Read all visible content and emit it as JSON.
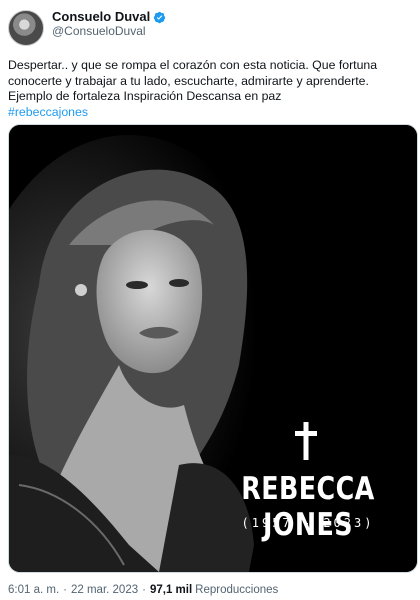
{
  "author": {
    "display_name": "Consuelo Duval",
    "handle": "@ConsueloDuval",
    "verified": true
  },
  "tweet": {
    "text": "Despertar.. y que se rompa el corazón con esta noticia. Que fortuna conocerte y trabajar a tu lado, escucharte, admirarte y aprenderte. Ejemplo de fortaleza Inspiración Descansa en paz",
    "hashtag": "#rebeccajones"
  },
  "media": {
    "name": "REBECCA JONES",
    "years": "(1957 - 2023)",
    "cross_glyph": "†"
  },
  "meta": {
    "time": "6:01 a. m.",
    "separator": "·",
    "date": "22 mar. 2023",
    "views_count": "97,1 mil",
    "views_label": "Reproducciones"
  },
  "colors": {
    "link": "#1d9bf0",
    "verified": "#1d9bf0",
    "secondary_text": "#536471"
  }
}
